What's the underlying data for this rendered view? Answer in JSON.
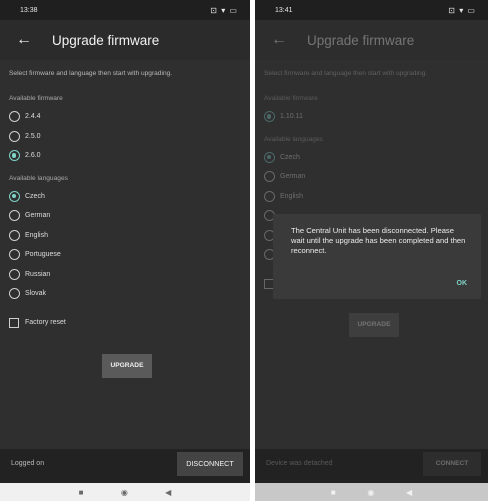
{
  "left": {
    "status_time": "13:38",
    "status_icons": "⊡ ▾ ▭",
    "back_icon": "←",
    "title": "Upgrade firmware",
    "intro": "Select firmware and language then start with upgrading.",
    "firmware_label": "Available firmware",
    "firmware": [
      {
        "label": "2.4.4",
        "checked": false
      },
      {
        "label": "2.5.0",
        "checked": false
      },
      {
        "label": "2.6.0",
        "checked": true
      }
    ],
    "languages_label": "Available languages",
    "languages": [
      {
        "label": "Czech",
        "checked": true
      },
      {
        "label": "German",
        "checked": false
      },
      {
        "label": "English",
        "checked": false
      },
      {
        "label": "Portuguese",
        "checked": false
      },
      {
        "label": "Russian",
        "checked": false
      },
      {
        "label": "Slovak",
        "checked": false
      }
    ],
    "factory_reset": "Factory reset",
    "upgrade_button": "UPGRADE",
    "footer_status": "Logged on",
    "disconnect_button": "DISCONNECT",
    "nav_square": "■",
    "nav_home": "◉",
    "nav_back": "◀"
  },
  "right": {
    "status_time": "13:41",
    "status_icons": "⊡ ▾ ▭",
    "back_icon": "←",
    "title": "Upgrade firmware",
    "intro": "Select firmware and language then start with upgrading.",
    "firmware_label": "Available firmware",
    "firmware": [
      {
        "label": "1.10.11",
        "checked": true
      }
    ],
    "languages_label": "Available languages",
    "languages": [
      {
        "label": "Czech",
        "checked": true
      },
      {
        "label": "German",
        "checked": false
      },
      {
        "label": "English",
        "checked": false
      }
    ],
    "upgrade_button": "UPGRADE",
    "footer_status": "Device was detached",
    "connect_button": "CONNECT",
    "dialog_message": "The Central Unit has been disconnected. Please wait until the upgrade has been completed and then reconnect.",
    "dialog_ok": "OK",
    "nav_square": "■",
    "nav_home": "◉",
    "nav_back": "◀"
  },
  "colors": {
    "accent": "#7fd3c6",
    "background": "#2f2f2f"
  }
}
